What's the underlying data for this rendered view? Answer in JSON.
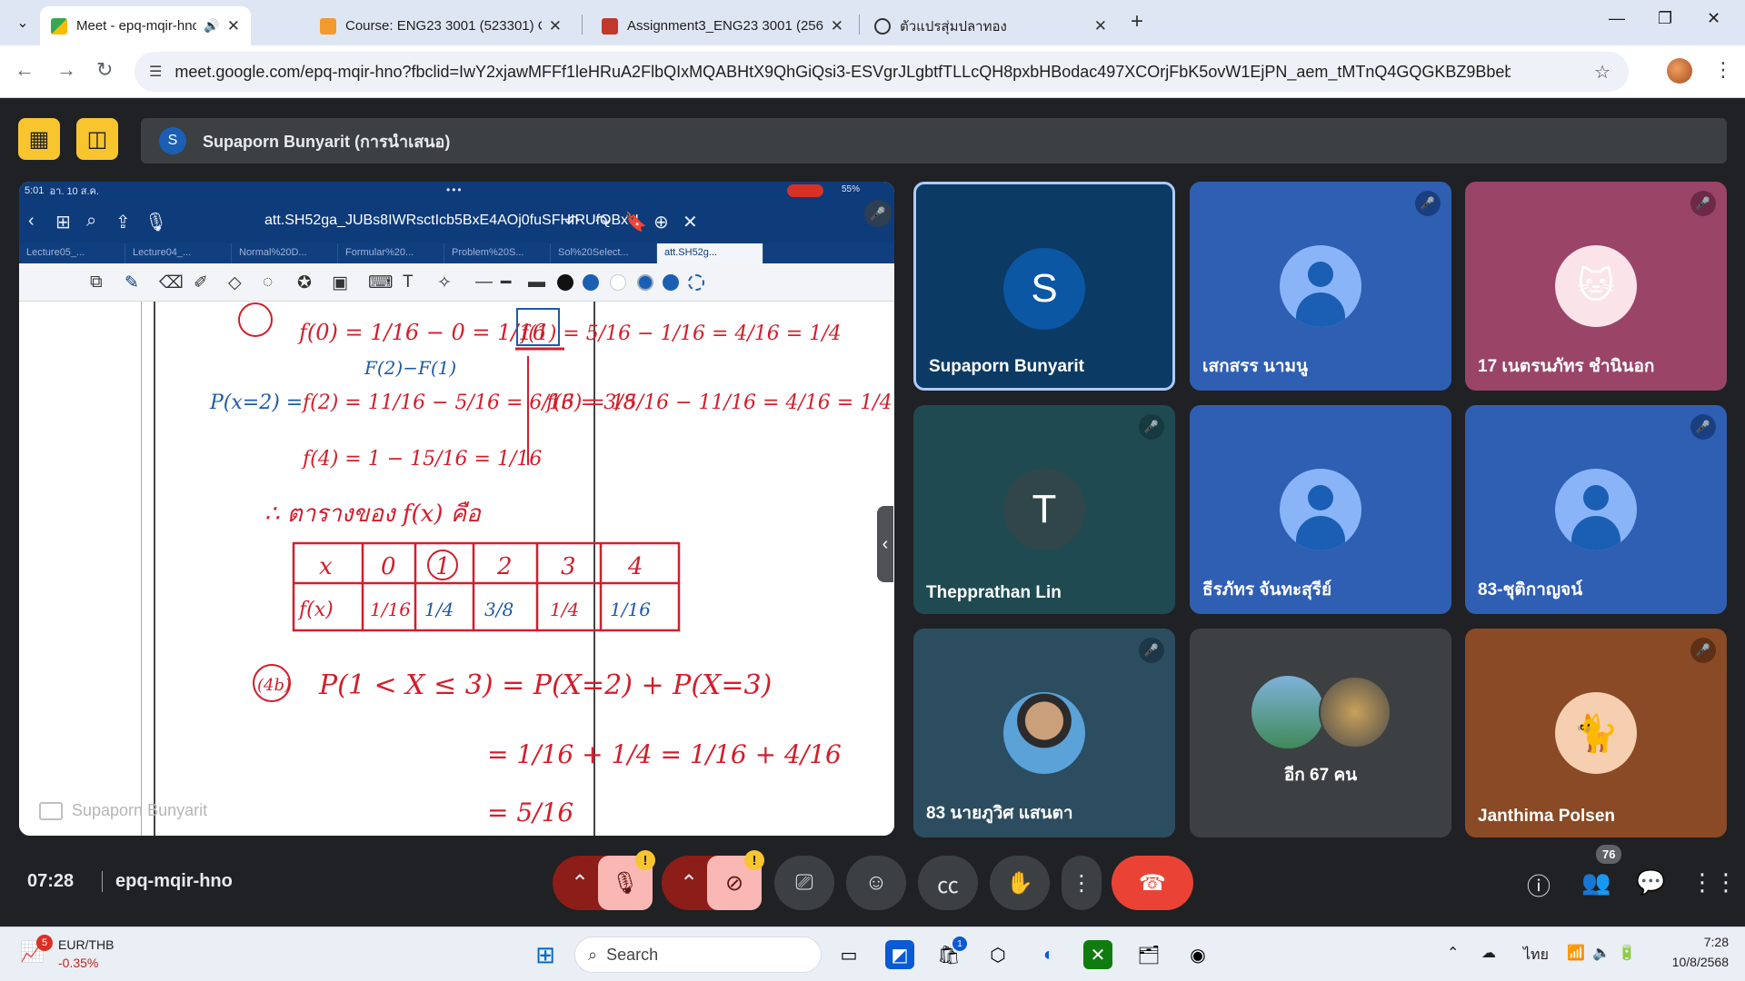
{
  "browser": {
    "tabs": [
      {
        "label": "Meet - epq-mqir-hno",
        "active": true,
        "favicon": "meet-icon",
        "audio": true
      },
      {
        "label": "Course: ENG23 3001 (523301) C",
        "active": false,
        "favicon": "sut-icon"
      },
      {
        "label": "Assignment3_ENG23 3001 (256",
        "active": false,
        "favicon": "pdf-icon"
      },
      {
        "label": "ตัวแปรสุ่มปลาทอง",
        "active": false,
        "favicon": "chatgpt-icon"
      }
    ],
    "url": "meet.google.com/epq-mqir-hno?fbclid=IwY2xjawMFFf1leHRuA2FlbQIxMQABHtX9QhGiQsi3-ESVgrJLgbtfTLLcQH8pxbHBodac497XCOrjFbK5ovW1EjPN_aem_tMTnQ4GQGKBZ9BbebmzBUQ"
  },
  "meet": {
    "presenter_avatar_letter": "S",
    "presenter_text": "Supaporn Bunyarit (การนำเสนอ)",
    "shared_screen": {
      "status_time": "5:01",
      "status_date": "อา. 10 ส.ค.",
      "status_dots": "•••",
      "battery": "55%",
      "doc_title": "att.SH52ga_JUBs8IWRsctIcb5BxE4AOj0fuSFHIRUfQBxU",
      "doc_tabs": [
        "Lecture05_...",
        "Lecture04_...",
        "Normal%20D...",
        "Formular%20...",
        "Problem%20S...",
        "Sol%20Select...",
        "att.SH52g..."
      ],
      "watermark": "Supaporn Bunyarit",
      "handwriting": {
        "line1": "f(0)  =  1/16 − 0 = 1/16",
        "box": "f(1) = 5/16 − 1/16 = 4/16 = 1/4",
        "fx_minus": "F(2)−F(1)",
        "line2_prefix": "P(x=2) =",
        "line2": "f(2)  =  11/16 − 5/16 = 6/16 = 3/8",
        "line2b": "f(3) = 15/16 − 11/16 = 4/16 = 1/4",
        "line3": "f(4)  =  1 − 15/16 = 1/16",
        "conclusion": "∴  ตารางของ   f(x)   คือ",
        "table_header": [
          "x",
          "0",
          "1",
          "2",
          "3",
          "4"
        ],
        "table_row": [
          "f(x)",
          "1/16",
          "1/4",
          "3/8",
          "1/4",
          "1/16"
        ],
        "part_b_label": "(4b)",
        "part_b_1": "P(1 < X ≤ 3) = P(X=2) + P(X=3)",
        "part_b_2": "=  1/16 + 1/4 = 1/16 + 4/16",
        "part_b_3": "=  5/16"
      }
    },
    "participants": [
      {
        "name": "Supaporn Bunyarit",
        "avatar_letter": "S",
        "bg": "#0b3a64",
        "avatar_bg": "#0b57a4",
        "muted": false,
        "active_speaker": true
      },
      {
        "name": "เสกสรร นามนู",
        "avatar": "person-icon",
        "bg": "#2f5fb3",
        "muted": true
      },
      {
        "name": "17 เนตรนภัทร ชำนินอก",
        "avatar": "hello-kitty-image",
        "bg": "#9a4468",
        "muted": true
      },
      {
        "name": "Thepprathan Lin",
        "avatar_letter": "T",
        "bg": "#1f4a52",
        "avatar_bg": "#30464b",
        "muted": true
      },
      {
        "name": "ธีรภัทร จันทะสุรีย์",
        "avatar": "person-icon",
        "bg": "#2f5fb3",
        "muted": false
      },
      {
        "name": "83-ชุติกาญจน์",
        "avatar": "person-icon",
        "bg": "#2f5fb3",
        "muted": true
      },
      {
        "name": "83 นายภูวิศ แสนตา",
        "avatar": "photo-avatar",
        "bg": "#2c4d60",
        "muted": true
      },
      {
        "name": "อีก 67 คน",
        "avatar": "group-avatars",
        "bg": "#3c4043",
        "muted": false
      },
      {
        "name": "Janthima Polsen",
        "avatar": "cat-image",
        "bg": "#8a4a25",
        "muted": true
      }
    ],
    "clock": "07:28",
    "meeting_code": "epq-mqir-hno",
    "participant_count": "76"
  },
  "taskbar": {
    "widget_badge": "5",
    "widget_title": "EUR/THB",
    "widget_value": "-0.35%",
    "search_placeholder": "Search",
    "store_badge": "1",
    "lang": "ไทย",
    "time": "7:28",
    "date": "10/8/2568"
  },
  "colors": {
    "meet_bg": "#202124",
    "accent_yellow": "#f8c52f",
    "hangup_red": "#ea4335",
    "ink_red": "#d21e2b",
    "ink_blue": "#1d5aa6"
  }
}
